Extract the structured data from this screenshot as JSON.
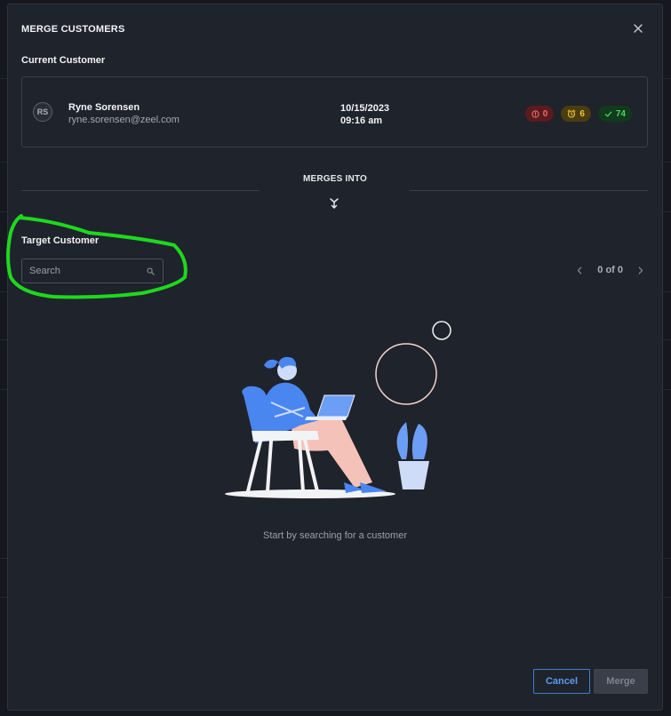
{
  "modal": {
    "title": "MERGE CUSTOMERS",
    "current_label": "Current Customer",
    "target_label": "Target Customer",
    "merges_into": "MERGES INTO"
  },
  "current_customer": {
    "initials": "RS",
    "name": "Ryne Sorensen",
    "email": "ryne.sorensen@zeel.com",
    "date": "10/15/2023",
    "time": "09:16 am",
    "badges": [
      {
        "icon": "alert-circle-icon",
        "value": "0",
        "color": "#f06b6b"
      },
      {
        "icon": "alarm-clock-icon",
        "value": "6",
        "color": "#f0c63a"
      },
      {
        "icon": "check-icon",
        "value": "74",
        "color": "#48d66a"
      }
    ]
  },
  "search": {
    "placeholder": "Search"
  },
  "pager": {
    "text": "0 of 0"
  },
  "empty_state": {
    "message": "Start by searching for a customer"
  },
  "footer": {
    "cancel_label": "Cancel",
    "merge_label": "Merge"
  },
  "colors": {
    "accent": "#3d7fd9",
    "highlight": "#1ed81e"
  }
}
